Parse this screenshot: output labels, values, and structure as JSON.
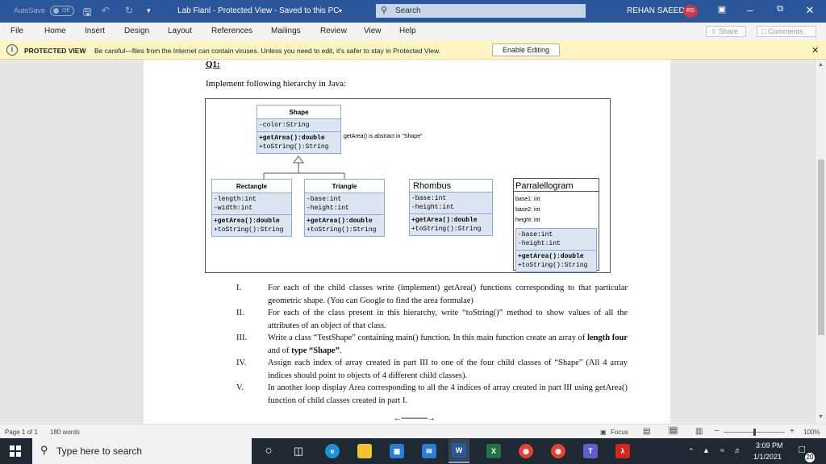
{
  "titlebar": {
    "autosave": "AutoSave",
    "autosave_state": "Off",
    "doc_title": "Lab Fianl  -  Protected View  -  Saved to this PC",
    "search_placeholder": "Search",
    "user": "REHAN SAEED",
    "avatar": "RS"
  },
  "menu": {
    "items": [
      "File",
      "Home",
      "Insert",
      "Design",
      "Layout",
      "References",
      "Mailings",
      "Review",
      "View",
      "Help"
    ],
    "share": "Share",
    "comments": "Comments"
  },
  "protected": {
    "label": "PROTECTED VIEW",
    "message": "Be careful—files from the Internet can contain viruses. Unless you need to edit, it's safer to stay in Protected View.",
    "enable_button": "Enable Editing"
  },
  "document": {
    "heading": "Q1:",
    "intro": "Implement following hierarchy in Java:",
    "uml": {
      "shape": {
        "name": "Shape",
        "attrs": [
          "-color:String"
        ],
        "methods": [
          "+getArea():double",
          "+toString():String"
        ]
      },
      "note": "getArea() is abstract in \"Shape\"",
      "rectangle": {
        "name": "Rectangle",
        "attrs": [
          "-length:int",
          "-width:int"
        ],
        "methods": [
          "+getArea():double",
          "+toString():String"
        ]
      },
      "triangle": {
        "name": "Triangle",
        "attrs": [
          "-base:int",
          "-height:int"
        ],
        "methods": [
          "+getArea():double",
          "+toString():String"
        ]
      },
      "rhombus": {
        "name": "Rhombus",
        "attrs": [
          "-base:int",
          "-height:int"
        ],
        "methods": [
          "+getArea():double",
          "+toString():String"
        ]
      },
      "parallelogram": {
        "name": "Parralellogram",
        "notes": [
          "base1: int",
          "base2: int",
          "height: int"
        ],
        "attrs": [
          "-base:int",
          "-height:int"
        ],
        "methods": [
          "+getArea():double",
          "+toString():String"
        ]
      }
    },
    "items": [
      {
        "num": "I.",
        "text": "For each of the child classes write (implement) getArea() functions corresponding to that particular geometric shape. (You can Google to find the area formulae)"
      },
      {
        "num": "II.",
        "text": "For each of the class present in this hierarchy, write “toString()” method to show values of all the attributes of an object of that class."
      },
      {
        "num": "III.",
        "text_pre": "Write a class “TestShape” containing main() function. In this main function create an array of ",
        "bold1": "length four",
        "text_mid": " and of ",
        "bold2": "type “Shape”",
        "text_post": "."
      },
      {
        "num": "IV.",
        "text": "Assign each index of array created in part III to one of the four child classes of “Shape” (All 4 array indices should point to objects of 4 different child classes)."
      },
      {
        "num": "V.",
        "text": "In another loop display Area corresponding to all the 4 indices of array created in part III using getArea() function of child classes created in part I."
      }
    ],
    "arrow": "←--------------→"
  },
  "status": {
    "page": "Page 1 of 1",
    "words": "180 words",
    "focus": "Focus",
    "zoom": "100%"
  },
  "taskbar": {
    "search_placeholder": "Type here to search",
    "time": "3:09 PM",
    "date": "1/1/2021",
    "notifications": "20"
  }
}
